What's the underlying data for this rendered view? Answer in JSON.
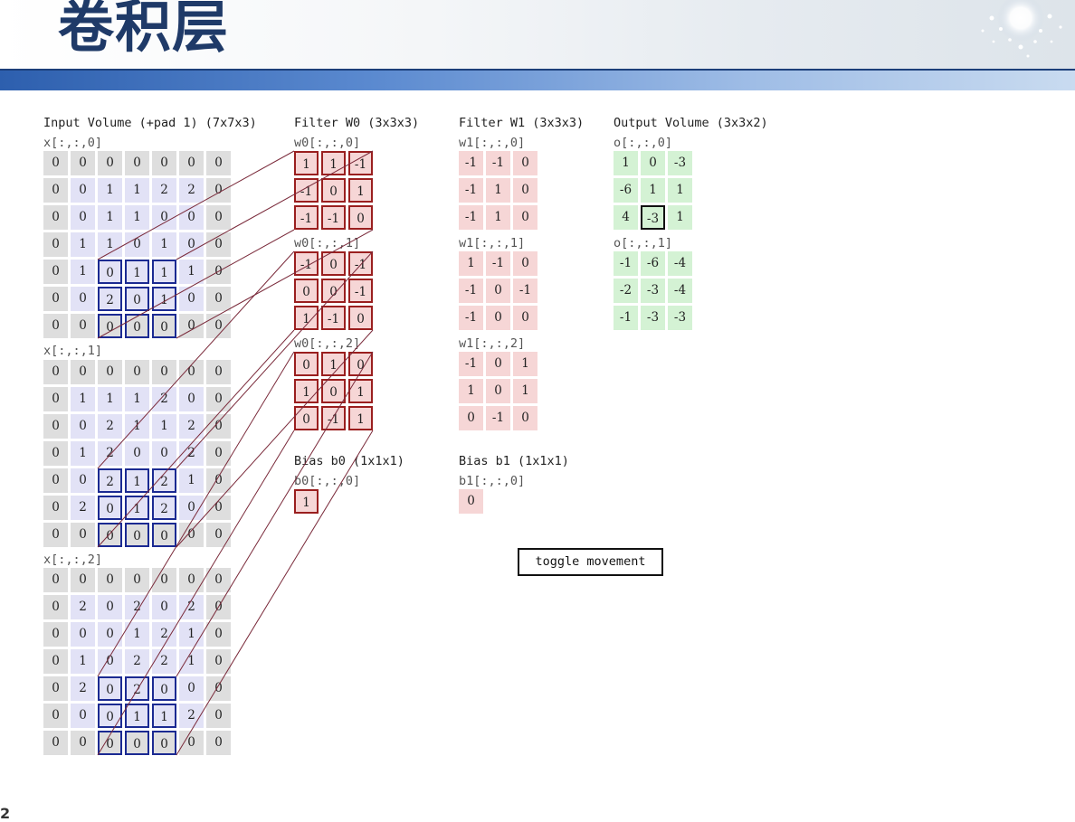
{
  "title": "卷积层",
  "page_number": "2",
  "input": {
    "label": "Input Volume (+pad 1) (7x7x3)",
    "slices": [
      {
        "label": "x[:,:,0]",
        "rows": [
          [
            0,
            0,
            0,
            0,
            0,
            0,
            0
          ],
          [
            0,
            0,
            1,
            1,
            2,
            2,
            0
          ],
          [
            0,
            0,
            1,
            1,
            0,
            0,
            0
          ],
          [
            0,
            1,
            1,
            0,
            1,
            0,
            0
          ],
          [
            0,
            1,
            0,
            1,
            1,
            1,
            0
          ],
          [
            0,
            0,
            2,
            0,
            1,
            0,
            0
          ],
          [
            0,
            0,
            0,
            0,
            0,
            0,
            0
          ]
        ]
      },
      {
        "label": "x[:,:,1]",
        "rows": [
          [
            0,
            0,
            0,
            0,
            0,
            0,
            0
          ],
          [
            0,
            1,
            1,
            1,
            2,
            0,
            0
          ],
          [
            0,
            0,
            2,
            1,
            1,
            2,
            0
          ],
          [
            0,
            1,
            2,
            0,
            0,
            2,
            0
          ],
          [
            0,
            0,
            2,
            1,
            2,
            1,
            0
          ],
          [
            0,
            2,
            0,
            1,
            2,
            0,
            0
          ],
          [
            0,
            0,
            0,
            0,
            0,
            0,
            0
          ]
        ]
      },
      {
        "label": "x[:,:,2]",
        "rows": [
          [
            0,
            0,
            0,
            0,
            0,
            0,
            0
          ],
          [
            0,
            2,
            0,
            2,
            0,
            2,
            0
          ],
          [
            0,
            0,
            0,
            1,
            2,
            1,
            0
          ],
          [
            0,
            1,
            0,
            2,
            2,
            1,
            0
          ],
          [
            0,
            2,
            0,
            2,
            0,
            0,
            0
          ],
          [
            0,
            0,
            0,
            1,
            1,
            2,
            0
          ],
          [
            0,
            0,
            0,
            0,
            0,
            0,
            0
          ]
        ]
      }
    ],
    "highlight": {
      "row": 4,
      "col": 2
    }
  },
  "filter_w0": {
    "label": "Filter W0 (3x3x3)",
    "slices": [
      {
        "label": "w0[:,:,0]",
        "rows": [
          [
            1,
            1,
            -1
          ],
          [
            -1,
            0,
            1
          ],
          [
            -1,
            -1,
            0
          ]
        ]
      },
      {
        "label": "w0[:,:,1]",
        "rows": [
          [
            -1,
            0,
            -1
          ],
          [
            0,
            0,
            -1
          ],
          [
            1,
            -1,
            0
          ]
        ]
      },
      {
        "label": "w0[:,:,2]",
        "rows": [
          [
            0,
            1,
            0
          ],
          [
            1,
            0,
            1
          ],
          [
            0,
            -1,
            1
          ]
        ]
      }
    ]
  },
  "filter_w1": {
    "label": "Filter W1 (3x3x3)",
    "slices": [
      {
        "label": "w1[:,:,0]",
        "rows": [
          [
            -1,
            -1,
            0
          ],
          [
            -1,
            1,
            0
          ],
          [
            -1,
            1,
            0
          ]
        ]
      },
      {
        "label": "w1[:,:,1]",
        "rows": [
          [
            1,
            -1,
            0
          ],
          [
            -1,
            0,
            -1
          ],
          [
            -1,
            0,
            0
          ]
        ]
      },
      {
        "label": "w1[:,:,2]",
        "rows": [
          [
            -1,
            0,
            1
          ],
          [
            1,
            0,
            1
          ],
          [
            0,
            -1,
            0
          ]
        ]
      }
    ]
  },
  "bias_b0": {
    "label": "Bias b0 (1x1x1)",
    "slice_label": "b0[:,:,0]",
    "value": 1
  },
  "bias_b1": {
    "label": "Bias b1 (1x1x1)",
    "slice_label": "b1[:,:,0]",
    "value": 0
  },
  "output": {
    "label": "Output Volume (3x3x2)",
    "slices": [
      {
        "label": "o[:,:,0]",
        "rows": [
          [
            1,
            0,
            -3
          ],
          [
            -6,
            1,
            1
          ],
          [
            4,
            -3,
            1
          ]
        ]
      },
      {
        "label": "o[:,:,1]",
        "rows": [
          [
            -1,
            -6,
            -4
          ],
          [
            -2,
            -3,
            -4
          ],
          [
            -1,
            -3,
            -3
          ]
        ]
      }
    ],
    "highlight": {
      "slice": 0,
      "row": 2,
      "col": 1
    }
  },
  "toggle_label": "toggle movement",
  "colors": {
    "input_cell": "#e2e2f6",
    "pad_cell": "#dedede",
    "weight_cell": "#f6d6d6",
    "output_cell": "#d4f2d4",
    "input_highlight": "#1b2a92",
    "weight_highlight": "#9a1f1f",
    "title": "#1f3a68",
    "band": "#2d5fae"
  }
}
